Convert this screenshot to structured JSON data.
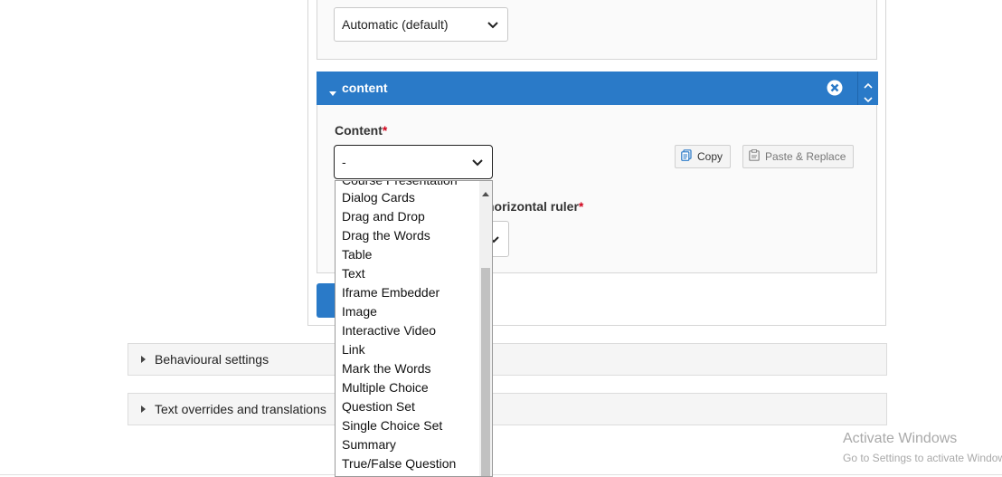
{
  "layout_select": {
    "value": "Automatic (default)"
  },
  "content_group": {
    "title": "content",
    "field_label": "Content",
    "required_mark": "*",
    "select_value": "-",
    "copy_label": "Copy",
    "paste_label": "Paste & Replace",
    "hr_label_partial": "horizontal ruler",
    "hr_required_mark": "*"
  },
  "dropdown": {
    "clipped_top_item": "Course Presentation",
    "items": [
      "Dialog Cards",
      "Drag and Drop",
      "Drag the Words",
      "Table",
      "Text",
      "Iframe Embedder",
      "Image",
      "Interactive Video",
      "Link",
      "Mark the Words",
      "Multiple Choice",
      "Question Set",
      "Single Choice Set",
      "Summary",
      "True/False Question"
    ]
  },
  "sections": {
    "behavioural": "Behavioural settings",
    "text_overrides": "Text overrides and translations"
  },
  "watermark": {
    "line1": "Activate Windows",
    "line2": "Go to Settings to activate Windows."
  },
  "colors": {
    "accent": "#2a7ac8",
    "required": "#d0021b"
  }
}
